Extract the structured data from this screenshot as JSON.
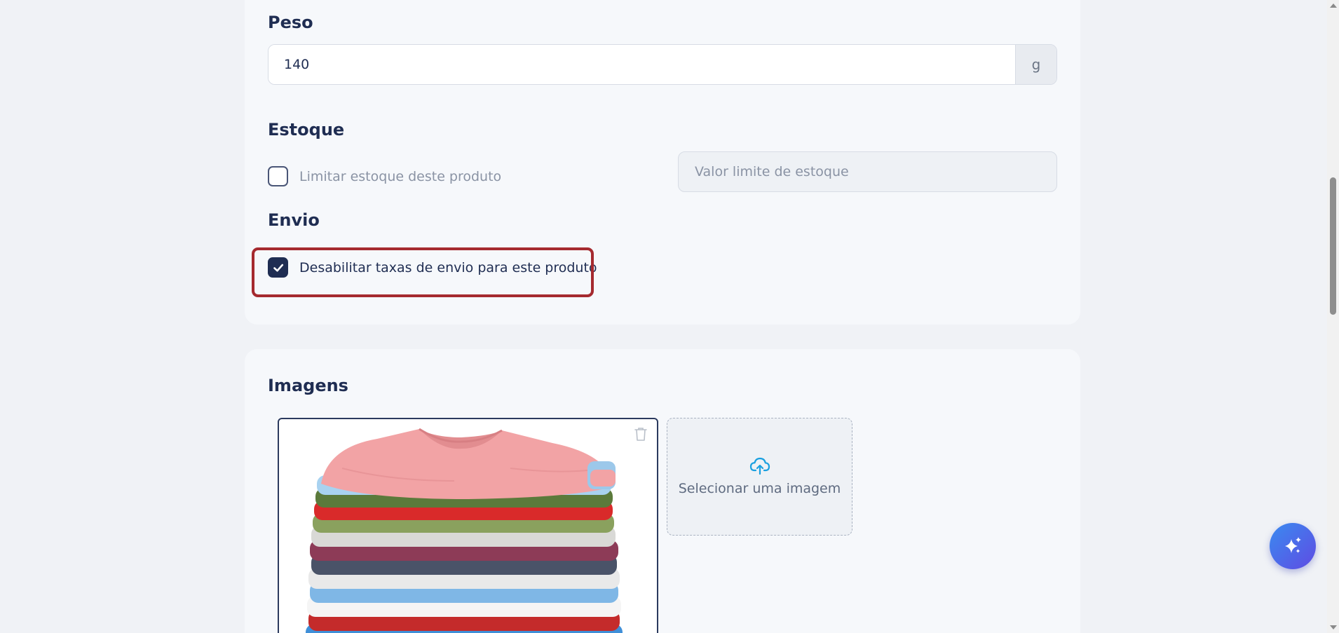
{
  "weight": {
    "title": "Peso",
    "value": "140",
    "unit": "g"
  },
  "stock": {
    "title": "Estoque",
    "limit_checkbox_label": "Limitar estoque deste produto",
    "limit_checked": false,
    "limit_placeholder": "Valor limite de estoque"
  },
  "shipping": {
    "title": "Envio",
    "disable_fees_label": "Desabilitar taxas de envio para este produto",
    "disable_fees_checked": true
  },
  "images": {
    "title": "Imagens",
    "upload_label": "Selecionar uma imagem",
    "thumbnail_alt": "stack-of-folded-t-shirts"
  },
  "icons": {
    "check": "check-icon",
    "trash": "trash-icon",
    "upload": "cloud-upload-icon",
    "ai": "sparkles-icon"
  },
  "colors": {
    "primary": "#1f2d52",
    "highlight": "#a52a2f",
    "upload_accent": "#1aa0e0",
    "fab_gradient_start": "#3a8bf0",
    "fab_gradient_end": "#5f4be3"
  }
}
